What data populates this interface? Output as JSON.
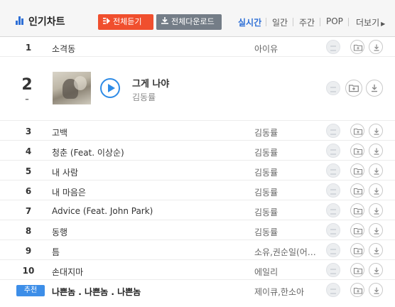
{
  "header": {
    "title": "인기차트",
    "play_all": "전체듣기",
    "download_all": "전체다운로드",
    "periods": [
      "실시간",
      "일간",
      "주간",
      "POP",
      "더보기"
    ],
    "active_period": "실시간"
  },
  "chart": [
    {
      "rank": "1",
      "title": "소격동",
      "artist": "아이유"
    },
    {
      "rank": "2",
      "title": "그게 나야",
      "artist": "김동률",
      "change": "–"
    },
    {
      "rank": "3",
      "title": "고백",
      "artist": "김동률"
    },
    {
      "rank": "4",
      "title": "청춘 (Feat. 이상순)",
      "artist": "김동률"
    },
    {
      "rank": "5",
      "title": "내 사람",
      "artist": "김동률"
    },
    {
      "rank": "6",
      "title": "내 마음은",
      "artist": "김동률"
    },
    {
      "rank": "7",
      "title": "Advice (Feat. John Park)",
      "artist": "김동률"
    },
    {
      "rank": "8",
      "title": "동행",
      "artist": "김동률"
    },
    {
      "rank": "9",
      "title": "틈",
      "artist": "소유,권순일(어…"
    },
    {
      "rank": "10",
      "title": "손대지마",
      "artist": "에일리"
    }
  ],
  "recommended": {
    "badge": "추천",
    "title": "나쁜놈 . 나쁜놈 . 나쁜놈",
    "artist": "제이큐,한소아"
  },
  "colors": {
    "accent": "#2e6fd6",
    "play_button": "#f04f2e",
    "download_button": "#747d87",
    "badge": "#3d8ee8"
  },
  "icons": {
    "chart": "bar-chart-icon",
    "comment": "comment-bubble-icon",
    "add": "add-to-folder-icon",
    "download": "download-icon",
    "play": "play-icon",
    "more": "chevron-right-icon"
  }
}
